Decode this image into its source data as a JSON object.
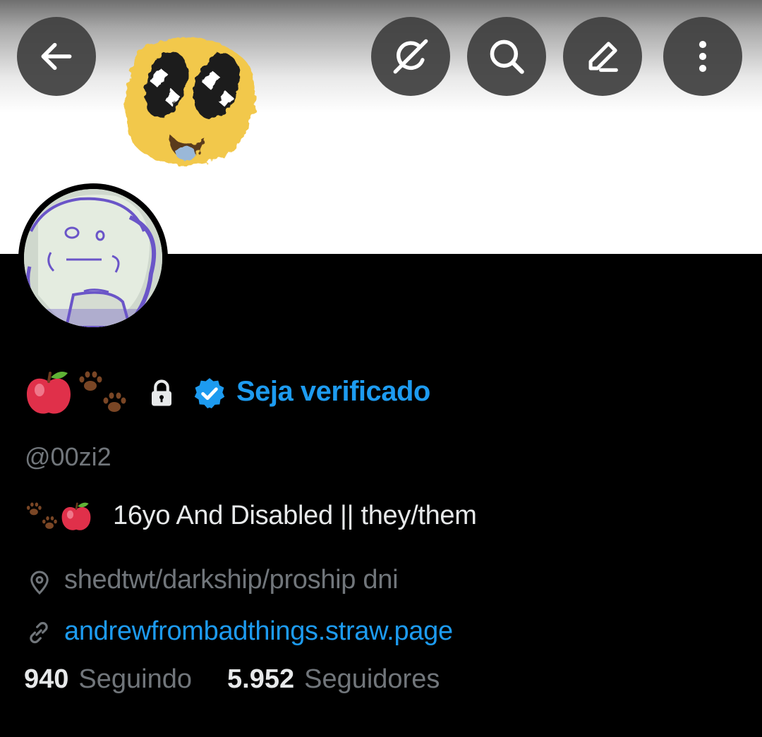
{
  "header": {
    "back_icon": "arrow-left-icon",
    "actions": [
      {
        "name": "grok",
        "icon": "grok-icon"
      },
      {
        "name": "search",
        "icon": "search-icon"
      },
      {
        "name": "edit",
        "icon": "pencil-icon"
      },
      {
        "name": "more",
        "icon": "more-vertical-icon"
      }
    ]
  },
  "profile": {
    "name_emojis": [
      "red-apple-emoji",
      "paw-prints-emoji"
    ],
    "protected_icon": "lock-icon",
    "verified_icon": "verified-badge-icon",
    "verify_label": "Seja verificado",
    "handle": "@00zi2",
    "bio_emojis": [
      "paw-prints-emoji",
      "red-apple-emoji"
    ],
    "bio": "16yo And Disabled || they/them",
    "location_icon": "location-pin-icon",
    "location": "shedtwt/darkship/proship dni",
    "link_icon": "link-icon",
    "link": "andrewfrombadthings.straw.page",
    "following_count": "940",
    "following_label": "Seguindo",
    "followers_count": "5.952",
    "followers_label": "Seguidores"
  },
  "colors": {
    "background": "#000000",
    "accent": "#1d9bf0",
    "primary_text": "#e7e9ea",
    "secondary_text": "#71767b",
    "button_bg": "#404040"
  }
}
